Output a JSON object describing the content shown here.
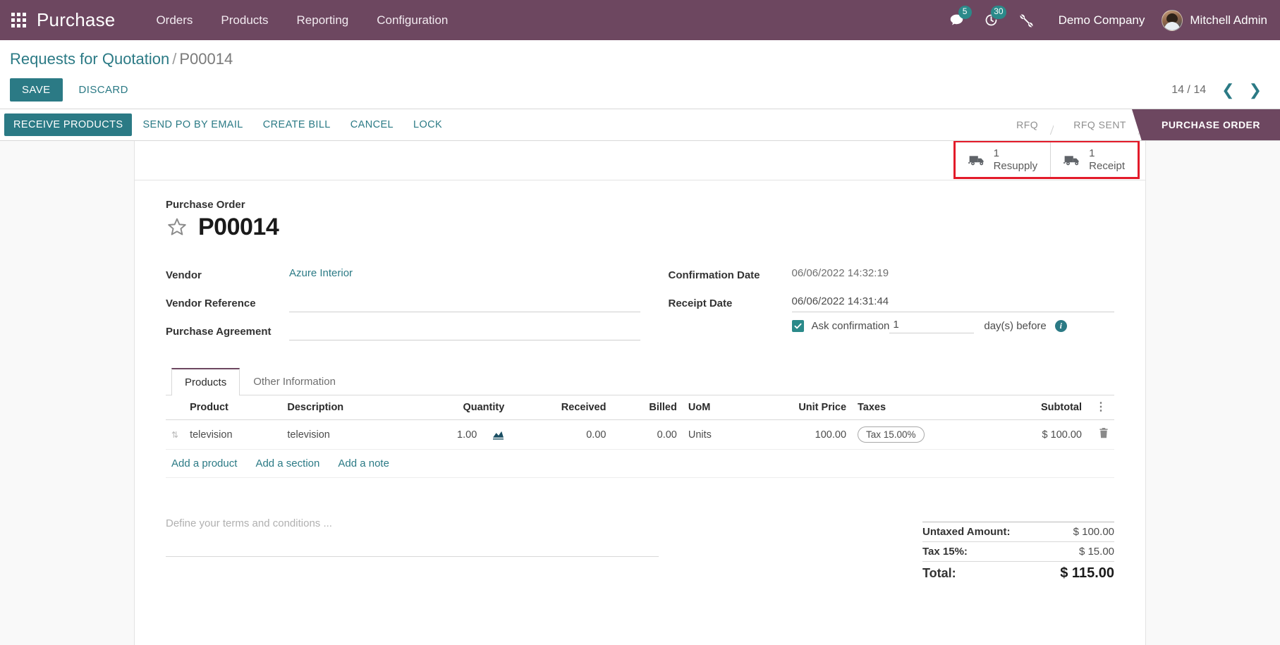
{
  "navbar": {
    "apps_icon": "apps-grid-icon",
    "brand": "Purchase",
    "menu": [
      {
        "label": "Orders"
      },
      {
        "label": "Products"
      },
      {
        "label": "Reporting"
      },
      {
        "label": "Configuration"
      }
    ],
    "messages_icon": "chat-bubble-icon",
    "messages_count": "5",
    "activities_icon": "clock-icon",
    "activities_count": "30",
    "debug_icon": "wrench-icon",
    "company": "Demo Company",
    "avatar_icon": "user-avatar",
    "user": "Mitchell Admin"
  },
  "control_panel": {
    "breadcrumb_root": "Requests for Quotation",
    "breadcrumb_separator": "/",
    "breadcrumb_current": "P00014",
    "save_label": "SAVE",
    "discard_label": "DISCARD",
    "pager_counter": "14 / 14",
    "pager_prev_icon": "chevron-left-icon",
    "pager_next_icon": "chevron-right-icon"
  },
  "statusbar": {
    "buttons": [
      {
        "label": "RECEIVE PRODUCTS",
        "primary": true
      },
      {
        "label": "SEND PO BY EMAIL",
        "primary": false
      },
      {
        "label": "CREATE BILL",
        "primary": false
      },
      {
        "label": "CANCEL",
        "primary": false
      },
      {
        "label": "LOCK",
        "primary": false
      }
    ],
    "stages": [
      {
        "label": "RFQ",
        "active": false
      },
      {
        "label": "RFQ SENT",
        "active": false
      },
      {
        "label": "PURCHASE ORDER",
        "active": true
      }
    ]
  },
  "smart_buttons": {
    "highlight_color": "#e31b2a",
    "items": [
      {
        "icon": "truck-icon",
        "value": "1",
        "label": "Resupply"
      },
      {
        "icon": "truck-icon",
        "value": "1",
        "label": "Receipt"
      }
    ]
  },
  "record": {
    "title_label": "Purchase Order",
    "star_icon": "star-outline-icon",
    "name": "P00014"
  },
  "form": {
    "left": [
      {
        "label": "Vendor",
        "value": "Azure Interior",
        "style": "link"
      },
      {
        "label": "Vendor Reference",
        "value": "",
        "style": "underline"
      },
      {
        "label": "Purchase Agreement",
        "value": "",
        "style": "dropdown"
      }
    ],
    "right": [
      {
        "label": "Confirmation Date",
        "value": "06/06/2022 14:32:19",
        "style": "muted"
      },
      {
        "label": "Receipt Date",
        "value": "06/06/2022 14:31:44",
        "style": "dropdown-underline"
      }
    ],
    "ask_confirmation": {
      "checked": true,
      "check_icon": "checkmark-icon",
      "label": "Ask confirmation",
      "days_value": "1",
      "suffix": "day(s) before",
      "info_icon": "info-icon",
      "info_glyph": "i"
    }
  },
  "notebook": {
    "tabs": [
      {
        "label": "Products",
        "active": true
      },
      {
        "label": "Other Information",
        "active": false
      }
    ],
    "columns": [
      {
        "label": "Product",
        "align": "left"
      },
      {
        "label": "Description",
        "align": "left"
      },
      {
        "label": "Quantity",
        "align": "right"
      },
      {
        "label": "Received",
        "align": "right"
      },
      {
        "label": "Billed",
        "align": "right"
      },
      {
        "label": "UoM",
        "align": "left"
      },
      {
        "label": "Unit Price",
        "align": "right"
      },
      {
        "label": "Taxes",
        "align": "left"
      },
      {
        "label": "Subtotal",
        "align": "right"
      }
    ],
    "optional_columns_icon": "vertical-dots-icon",
    "optional_columns_glyph": "⋮",
    "rows": [
      {
        "handle_icon": "drag-handle-icon",
        "product": "television",
        "description": "television",
        "quantity": "1.00",
        "forecast_icon": "forecast-report-icon",
        "received": "0.00",
        "billed": "0.00",
        "uom": "Units",
        "unit_price": "100.00",
        "taxes": "Tax 15.00%",
        "subtotal": "$ 100.00",
        "delete_icon": "trash-icon"
      }
    ],
    "add_links": [
      {
        "label": "Add a product"
      },
      {
        "label": "Add a section"
      },
      {
        "label": "Add a note"
      }
    ]
  },
  "footer": {
    "terms_placeholder": "Define your terms and conditions ...",
    "totals": [
      {
        "label": "Untaxed Amount:",
        "value": "$ 100.00",
        "grand": false
      },
      {
        "label": "Tax 15%:",
        "value": "$ 15.00",
        "grand": false
      },
      {
        "label": "Total:",
        "value": "$ 115.00",
        "grand": true
      }
    ]
  },
  "colors": {
    "brand_purple": "#6d4760",
    "accent_teal": "#2b7a85",
    "highlight_red": "#e31b2a"
  }
}
